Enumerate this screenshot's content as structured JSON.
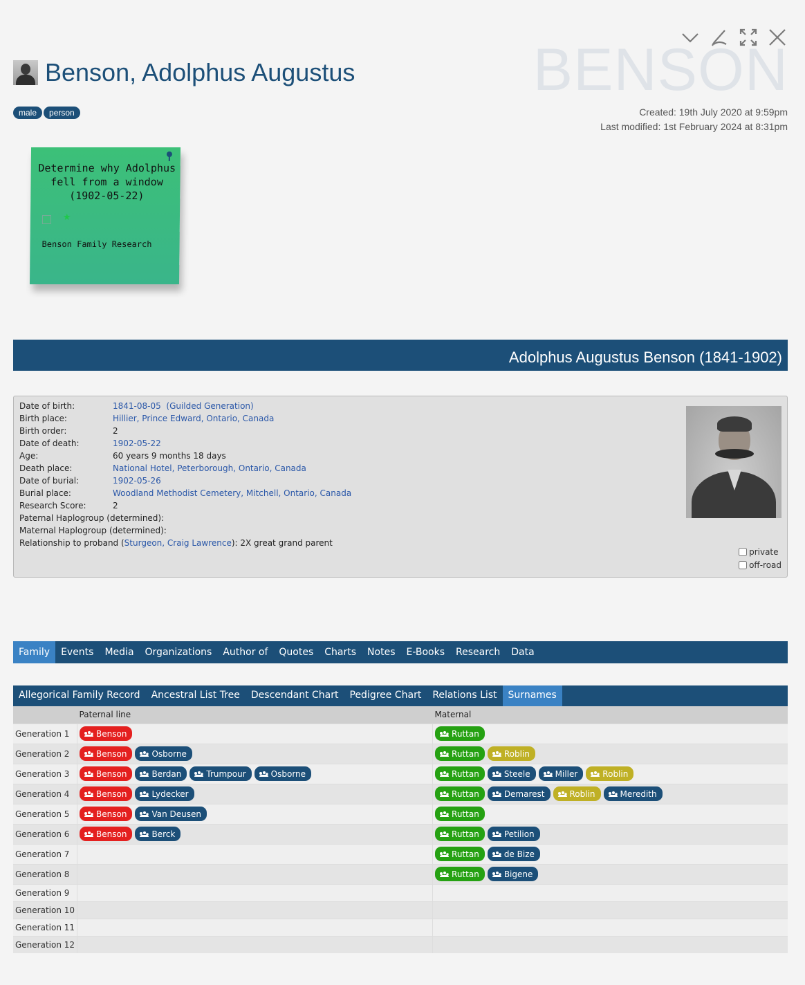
{
  "header": {
    "title": "Benson, Adolphus Augustus",
    "watermark": "BENSON",
    "tags": [
      "male",
      "person"
    ],
    "created": "Created: 19th July 2020 at 9:59pm",
    "modified": "Last modified: 1st February 2024 at 8:31pm"
  },
  "note": {
    "text": "Determine why Adolphus fell from a window (1902-05-22)",
    "project": "Benson Family Research"
  },
  "banner": {
    "title": "Adolphus Augustus Benson (1841-1902)"
  },
  "details": {
    "birth_date_label": "Date of birth:",
    "birth_date": "1841-08-05",
    "birth_generation": "(Guilded Generation)",
    "birth_place_label": "Birth place:",
    "birth_place": "Hillier, Prince Edward, Ontario, Canada",
    "birth_order_label": "Birth order:",
    "birth_order": "2",
    "death_date_label": "Date of death:",
    "death_date": "1902-05-22",
    "age_label": "Age:",
    "age": "60 years 9 months 18 days",
    "death_place_label": "Death place:",
    "death_place": "National Hotel, Peterborough, Ontario, Canada",
    "burial_date_label": "Date of burial:",
    "burial_date": "1902-05-26",
    "burial_place_label": "Burial place:",
    "burial_place": "Woodland Methodist Cemetery, Mitchell, Ontario, Canada",
    "research_score_label": "Research Score:",
    "research_score": "2",
    "paternal_haplo_label": "Paternal Haplogroup (determined):",
    "maternal_haplo_label": "Maternal Haplogroup (determined):",
    "relationship_prefix": "Relationship to proband (",
    "proband": "Sturgeon, Craig Lawrence",
    "relationship_suffix": "): 2X great grand parent",
    "private_label": "private",
    "offroad_label": "off-road"
  },
  "tabs": [
    "Family",
    "Events",
    "Media",
    "Organizations",
    "Author of",
    "Quotes",
    "Charts",
    "Notes",
    "E-Books",
    "Research",
    "Data"
  ],
  "active_tab": "Family",
  "subtabs": [
    "Allegorical Family Record",
    "Ancestral List Tree",
    "Descendant Chart",
    "Pedigree Chart",
    "Relations List",
    "Surnames"
  ],
  "active_subtab": "Surnames",
  "surnames": {
    "col_paternal": "Paternal line",
    "col_maternal": "Maternal",
    "colors": {
      "red": "#e4201f",
      "blue": "#1c4f78",
      "green": "#25a112",
      "olive": "#bfb025"
    },
    "rows": [
      {
        "gen": "Generation 1",
        "paternal": [
          [
            "Benson",
            "red"
          ]
        ],
        "maternal": [
          [
            "Ruttan",
            "green"
          ]
        ]
      },
      {
        "gen": "Generation 2",
        "paternal": [
          [
            "Benson",
            "red"
          ],
          [
            "Osborne",
            "blue"
          ]
        ],
        "maternal": [
          [
            "Ruttan",
            "green"
          ],
          [
            "Roblin",
            "olive"
          ]
        ]
      },
      {
        "gen": "Generation 3",
        "paternal": [
          [
            "Benson",
            "red"
          ],
          [
            "Berdan",
            "blue"
          ],
          [
            "Trumpour",
            "blue"
          ],
          [
            "Osborne",
            "blue"
          ]
        ],
        "maternal": [
          [
            "Ruttan",
            "green"
          ],
          [
            "Steele",
            "blue"
          ],
          [
            "Miller",
            "blue"
          ],
          [
            "Roblin",
            "olive"
          ]
        ]
      },
      {
        "gen": "Generation 4",
        "paternal": [
          [
            "Benson",
            "red"
          ],
          [
            "Lydecker",
            "blue"
          ]
        ],
        "maternal": [
          [
            "Ruttan",
            "green"
          ],
          [
            "Demarest",
            "blue"
          ],
          [
            "Roblin",
            "olive"
          ],
          [
            "Meredith",
            "blue"
          ]
        ]
      },
      {
        "gen": "Generation 5",
        "paternal": [
          [
            "Benson",
            "red"
          ],
          [
            "Van Deusen",
            "blue"
          ]
        ],
        "maternal": [
          [
            "Ruttan",
            "green"
          ]
        ]
      },
      {
        "gen": "Generation 6",
        "paternal": [
          [
            "Benson",
            "red"
          ],
          [
            "Berck",
            "blue"
          ]
        ],
        "maternal": [
          [
            "Ruttan",
            "green"
          ],
          [
            "Petilion",
            "blue"
          ]
        ]
      },
      {
        "gen": "Generation 7",
        "paternal": [],
        "maternal": [
          [
            "Ruttan",
            "green"
          ],
          [
            "de Bize",
            "blue"
          ]
        ]
      },
      {
        "gen": "Generation 8",
        "paternal": [],
        "maternal": [
          [
            "Ruttan",
            "green"
          ],
          [
            "Bigene",
            "blue"
          ]
        ]
      },
      {
        "gen": "Generation 9",
        "paternal": [],
        "maternal": []
      },
      {
        "gen": "Generation 10",
        "paternal": [],
        "maternal": []
      },
      {
        "gen": "Generation 11",
        "paternal": [],
        "maternal": []
      },
      {
        "gen": "Generation 12",
        "paternal": [],
        "maternal": []
      }
    ]
  }
}
